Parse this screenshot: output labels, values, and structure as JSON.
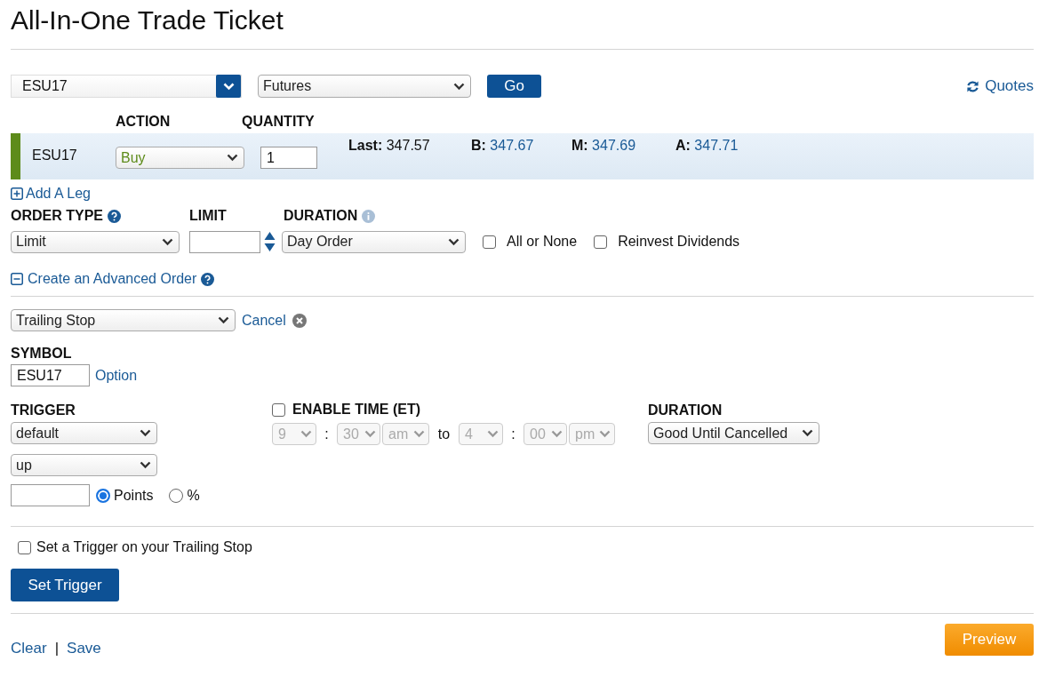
{
  "title": "All-In-One Trade Ticket",
  "symbol_bar": {
    "symbol": "ESU17",
    "security_type": "Futures",
    "go_button": "Go",
    "quotes_link": "Quotes"
  },
  "leg": {
    "action_label": "ACTION",
    "quantity_label": "QUANTITY",
    "symbol": "ESU17",
    "action": "Buy",
    "quantity": "1",
    "quotes": [
      {
        "label": "Last:",
        "value": "347.57",
        "kind": "plain"
      },
      {
        "label": "B:",
        "value": "347.67",
        "kind": "link"
      },
      {
        "label": "M:",
        "value": "347.69",
        "kind": "link"
      },
      {
        "label": "A:",
        "value": "347.71",
        "kind": "link"
      }
    ]
  },
  "add_leg": "Add A Leg",
  "order": {
    "order_type_label": "ORDER TYPE",
    "order_type": "Limit",
    "limit_label": "LIMIT",
    "duration_label": "DURATION",
    "duration": "Day Order",
    "options": [
      {
        "label": "All or None",
        "checked": false
      },
      {
        "label": "Reinvest Dividends",
        "checked": false
      }
    ]
  },
  "advanced": {
    "toggle": "Create an Advanced Order",
    "expanded": true,
    "type": "Trailing Stop",
    "cancel": "Cancel",
    "symbol_label": "SYMBOL",
    "symbol": "ESU17",
    "option_link": "Option",
    "trigger_label": "TRIGGER",
    "trigger_selects": [
      "default",
      "up"
    ],
    "units": [
      {
        "label": "Points",
        "selected": true
      },
      {
        "label": "%",
        "selected": false
      }
    ],
    "enable_time": {
      "label": "ENABLE TIME (ET)",
      "checked": false,
      "start": {
        "hour": "9",
        "separator": ":",
        "minute": "30",
        "ampm": "am"
      },
      "to": "to",
      "end": {
        "hour": "4",
        "separator": ":",
        "minute": "00",
        "ampm": "pm"
      }
    },
    "duration_label": "DURATION",
    "duration": "Good Until Cancelled"
  },
  "trailing_trigger": {
    "label": "Set a Trigger on your Trailing Stop",
    "checked": false,
    "button": "Set Trigger"
  },
  "footer": {
    "links": [
      "Clear",
      "Save"
    ],
    "separator": "|",
    "preview": "Preview"
  }
}
